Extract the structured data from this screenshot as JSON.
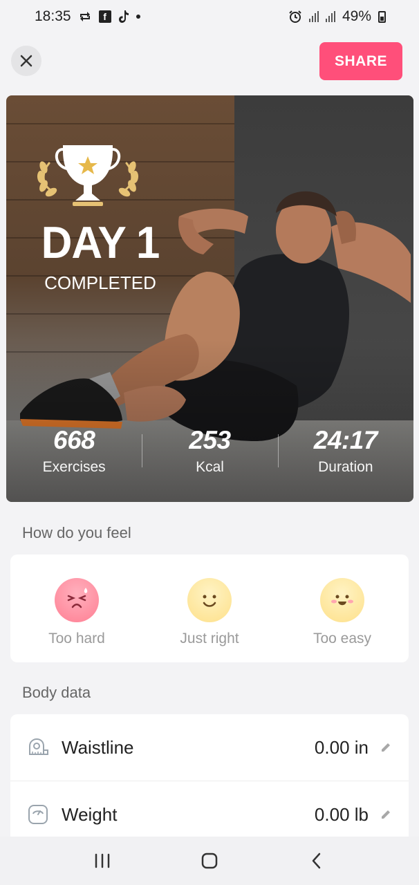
{
  "status_bar": {
    "time": "18:35",
    "battery_percent": "49%",
    "battery_level": 0.49,
    "icons": [
      "sync-icon",
      "facebook-icon",
      "tiktok-icon",
      "notification-dot-icon",
      "alarm-icon",
      "signal-icon",
      "signal-icon",
      "battery-icon"
    ]
  },
  "header": {
    "close_icon": "close-icon",
    "share_label": "SHARE",
    "share_color": "#ff4f7a"
  },
  "hero": {
    "trophy_icon": "trophy-icon",
    "title": "DAY 1",
    "subtitle": "COMPLETED",
    "stats": [
      {
        "value": "668",
        "label": "Exercises"
      },
      {
        "value": "253",
        "label": "Kcal"
      },
      {
        "value": "24:17",
        "label": "Duration"
      }
    ]
  },
  "feel": {
    "title": "How do you feel",
    "options": [
      {
        "label": "Too hard",
        "icon": "too-hard-face-icon",
        "color": "#ff7f93"
      },
      {
        "label": "Just right",
        "icon": "just-right-face-icon",
        "color": "#fde89a"
      },
      {
        "label": "Too easy",
        "icon": "too-easy-face-icon",
        "color": "#fde89a"
      }
    ]
  },
  "body_data": {
    "title": "Body data",
    "rows": [
      {
        "name": "Waistline",
        "value": "0.00 in",
        "icon": "tape-measure-icon"
      },
      {
        "name": "Weight",
        "value": "0.00 lb",
        "icon": "scale-icon"
      }
    ]
  },
  "nav_bar": {
    "icons": [
      "recent-apps-icon",
      "home-icon",
      "back-icon"
    ]
  }
}
